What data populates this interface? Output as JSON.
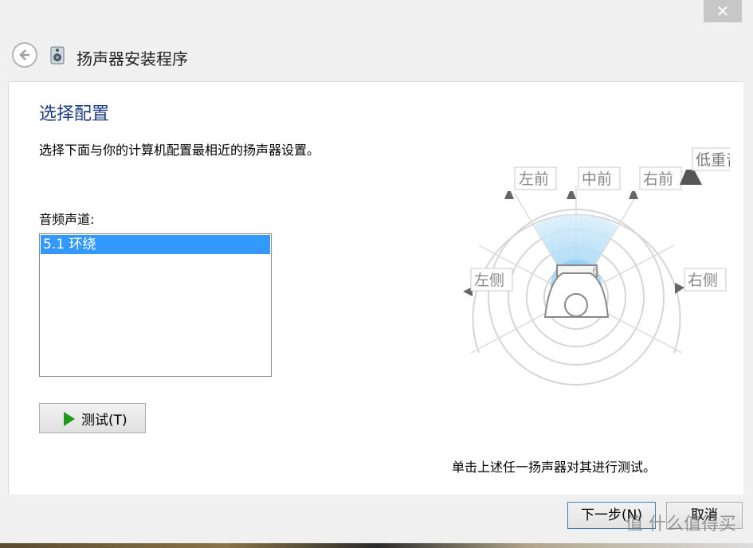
{
  "window": {
    "title": "扬声器安装程序",
    "close_symbol": "✕"
  },
  "page": {
    "heading": "选择配置",
    "instruction": "选择下面与你的计算机配置最相近的扬声器设置。",
    "channels_label": "音频声道:",
    "channels": [
      {
        "label": "5.1 环绕",
        "selected": true
      }
    ],
    "test_button": "测试(T)",
    "hint": "单击上述任一扬声器对其进行测试。"
  },
  "diagram": {
    "speakers": {
      "front_left": "左前",
      "center": "中前",
      "front_right": "右前",
      "subwoofer": "低重音",
      "side_left": "左侧",
      "side_right": "右侧"
    }
  },
  "footer": {
    "next_button": "下一步(N)",
    "cancel_button": "取消"
  },
  "watermark": "值 什么值得买",
  "icons": [
    "close-icon",
    "back-arrow-icon",
    "speaker-setup-icon",
    "play-icon",
    "speaker-icon",
    "subwoofer-icon",
    "listener-icon"
  ],
  "colors": {
    "heading": "#1c3d84",
    "selection": "#3399ff",
    "play": "#1e9a1e"
  }
}
